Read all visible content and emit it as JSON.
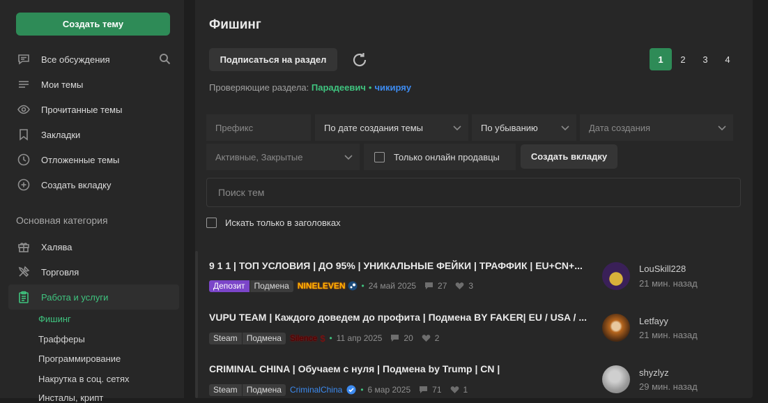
{
  "sidebar": {
    "create_thread": "Создать тему",
    "nav": [
      {
        "label": "Все обсуждения",
        "icon": "chat-icon"
      },
      {
        "label": "Мои темы",
        "icon": "lines-icon"
      },
      {
        "label": "Прочитанные темы",
        "icon": "eye-icon"
      },
      {
        "label": "Закладки",
        "icon": "bookmark-icon"
      },
      {
        "label": "Отложенные темы",
        "icon": "clock-icon"
      },
      {
        "label": "Создать вкладку",
        "icon": "plus-circle-icon"
      }
    ],
    "category_title": "Основная категория",
    "categories": [
      {
        "label": "Халява",
        "icon": "gift-icon"
      },
      {
        "label": "Торговля",
        "icon": "tools-icon"
      },
      {
        "label": "Работа и услуги",
        "icon": "clipboard-icon"
      }
    ],
    "subcategories": [
      "Фишинг",
      "Трафферы",
      "Программирование",
      "Накрутка в соц. сетях",
      "Инсталы, крипт"
    ]
  },
  "main": {
    "title": "Фишинг",
    "subscribe": "Подписаться на раздел",
    "pages": [
      "1",
      "2",
      "3",
      "4"
    ],
    "current_page": "1",
    "moderators_label": "Проверяющие раздела:",
    "moderators": [
      "Парадеевич",
      "чикиряу"
    ],
    "filters": {
      "prefix_placeholder": "Префикс",
      "sort_by": "По дате создания темы",
      "order": "По убыванию",
      "date_placeholder": "Дата создания",
      "status": "Активные, Закрытые",
      "online_sellers": "Только онлайн продавцы",
      "create_tab": "Создать вкладку"
    },
    "search_placeholder": "Поиск тем",
    "only_titles": "Искать только в заголовках"
  },
  "threads": [
    {
      "title": "9 1 1 | ТОП УСЛОВИЯ | ДО 95% | УНИКАЛЬНЫЕ ФЕЙКИ | ТРАФФИК | EU+CN+...",
      "tags": [
        "Депозит",
        "Подмена"
      ],
      "author": "NINELEVEN",
      "date": "24 май 2025",
      "replies": "27",
      "likes": "3",
      "last_user": "LouSkill228",
      "last_time": "21 мин. назад"
    },
    {
      "title": "VUPU TEAM | Каждого доведем до профита | Подмена BY FAKER| EU / USA / ...",
      "tags": [
        "Steam",
        "Подмена"
      ],
      "author": "Silence",
      "date": "11 апр 2025",
      "replies": "20",
      "likes": "2",
      "last_user": "Letfayy",
      "last_time": "21 мин. назад"
    },
    {
      "title": "CRIMINAL CHINA | Обучаем с нуля | Подмена by Trump | CN |",
      "tags": [
        "Steam",
        "Подмена"
      ],
      "author": "CriminalChina",
      "date": "6 мар 2025",
      "replies": "71",
      "likes": "1",
      "last_user": "shyzlyz",
      "last_time": "29 мин. назад"
    }
  ],
  "colors": {
    "accent": "#2e8b57",
    "accent_text": "#3fc47f",
    "link_blue": "#3d8bf0",
    "tag_purple": "#7b45c9"
  }
}
